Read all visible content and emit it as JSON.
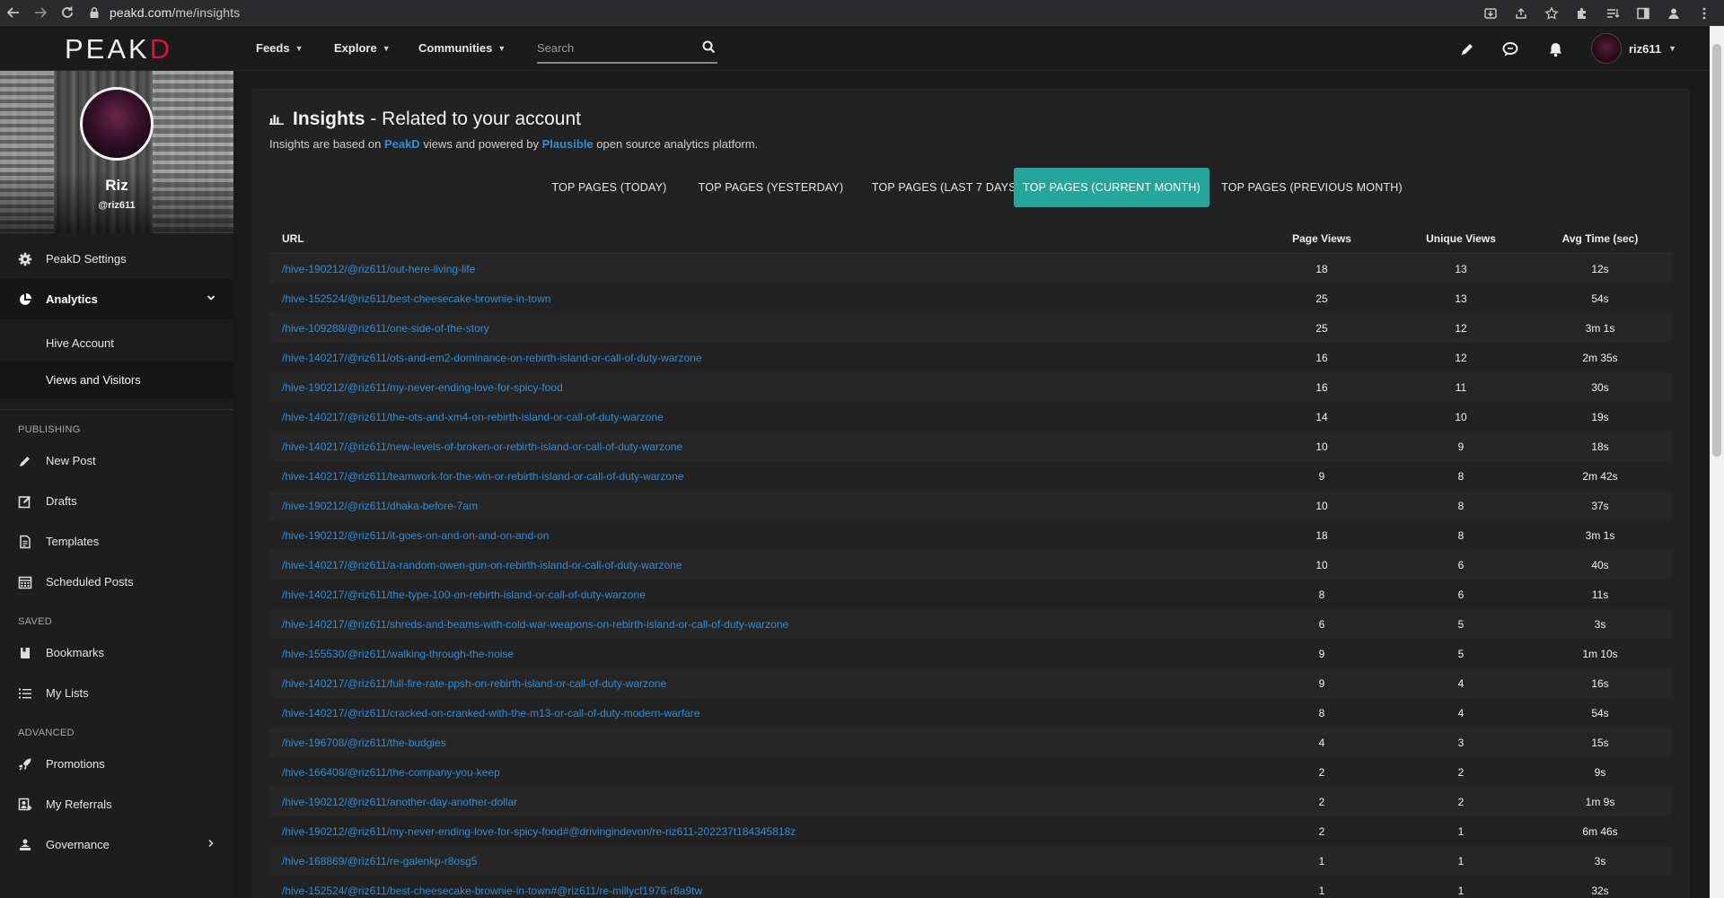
{
  "browser": {
    "url_host": "peakd.com",
    "url_path": "/me/insights"
  },
  "app": {
    "logo_main": "PEAK",
    "logo_accent": "D",
    "nav": [
      "Feeds",
      "Explore",
      "Communities"
    ],
    "search_placeholder": "Search",
    "username": "riz611",
    "accent_color": "#26a69a",
    "link_color": "#2f8dd8",
    "brand_red": "#e31337"
  },
  "profile": {
    "name": "Riz",
    "handle": "@riz611"
  },
  "sidebar": {
    "settings": "PeakD Settings",
    "analytics": "Analytics",
    "analytics_sub": [
      "Hive Account",
      "Views and Visitors"
    ],
    "sections": {
      "publishing": "PUBLISHING",
      "saved": "SAVED",
      "advanced": "ADVANCED"
    },
    "publishing": [
      "New Post",
      "Drafts",
      "Templates",
      "Scheduled Posts"
    ],
    "saved": [
      "Bookmarks",
      "My Lists"
    ],
    "advanced": [
      "Promotions",
      "My Referrals",
      "Governance"
    ]
  },
  "insights": {
    "title_bold": "Insights",
    "title_rest": "- Related to your account",
    "desc_1": "Insights are based on",
    "desc_link_1": "PeakD",
    "desc_2": "views and powered by",
    "desc_link_2": "Plausible",
    "desc_3": "open source analytics platform.",
    "tabs": [
      "TOP PAGES (TODAY)",
      "TOP PAGES (YESTERDAY)",
      "TOP PAGES (LAST 7 DAYS)",
      "TOP PAGES (CURRENT MONTH)",
      "TOP PAGES (PREVIOUS MONTH)"
    ],
    "active_tab": 3,
    "columns": [
      "URL",
      "Page Views",
      "Unique Views",
      "Avg Time (sec)"
    ],
    "rows": [
      {
        "url": "/hive-190212/@riz611/out-here-living-life",
        "views": "18",
        "unique": "13",
        "avg": "12s"
      },
      {
        "url": "/hive-152524/@riz611/best-cheesecake-brownie-in-town",
        "views": "25",
        "unique": "13",
        "avg": "54s"
      },
      {
        "url": "/hive-109288/@riz611/one-side-of-the-story",
        "views": "25",
        "unique": "12",
        "avg": "3m 1s"
      },
      {
        "url": "/hive-140217/@riz611/ots-and-em2-dominance-on-rebirth-island-or-call-of-duty-warzone",
        "views": "16",
        "unique": "12",
        "avg": "2m 35s"
      },
      {
        "url": "/hive-190212/@riz611/my-never-ending-love-for-spicy-food",
        "views": "16",
        "unique": "11",
        "avg": "30s"
      },
      {
        "url": "/hive-140217/@riz611/the-ots-and-xm4-on-rebirth-island-or-call-of-duty-warzone",
        "views": "14",
        "unique": "10",
        "avg": "19s"
      },
      {
        "url": "/hive-140217/@riz611/new-levels-of-broken-or-rebirth-island-or-call-of-duty-warzone",
        "views": "10",
        "unique": "9",
        "avg": "18s"
      },
      {
        "url": "/hive-140217/@riz611/teamwork-for-the-win-or-rebirth-island-or-call-of-duty-warzone",
        "views": "9",
        "unique": "8",
        "avg": "2m 42s"
      },
      {
        "url": "/hive-190212/@riz611/dhaka-before-7am",
        "views": "10",
        "unique": "8",
        "avg": "37s"
      },
      {
        "url": "/hive-190212/@riz611/it-goes-on-and-on-and-on-and-on",
        "views": "18",
        "unique": "8",
        "avg": "3m 1s"
      },
      {
        "url": "/hive-140217/@riz611/a-random-owen-gun-on-rebirth-island-or-call-of-duty-warzone",
        "views": "10",
        "unique": "6",
        "avg": "40s"
      },
      {
        "url": "/hive-140217/@riz611/the-type-100-on-rebirth-island-or-call-of-duty-warzone",
        "views": "8",
        "unique": "6",
        "avg": "11s"
      },
      {
        "url": "/hive-140217/@riz611/shreds-and-beams-with-cold-war-weapons-on-rebirth-island-or-call-of-duty-warzone",
        "views": "6",
        "unique": "5",
        "avg": "3s"
      },
      {
        "url": "/hive-155530/@riz611/walking-through-the-noise",
        "views": "9",
        "unique": "5",
        "avg": "1m 10s"
      },
      {
        "url": "/hive-140217/@riz611/full-fire-rate-ppsh-on-rebirth-island-or-call-of-duty-warzone",
        "views": "9",
        "unique": "4",
        "avg": "16s"
      },
      {
        "url": "/hive-140217/@riz611/cracked-on-cranked-with-the-m13-or-call-of-duty-modern-warfare",
        "views": "8",
        "unique": "4",
        "avg": "54s"
      },
      {
        "url": "/hive-196708/@riz611/the-budgies",
        "views": "4",
        "unique": "3",
        "avg": "15s"
      },
      {
        "url": "/hive-166408/@riz611/the-company-you-keep",
        "views": "2",
        "unique": "2",
        "avg": "9s"
      },
      {
        "url": "/hive-190212/@riz611/another-day-another-dollar",
        "views": "2",
        "unique": "2",
        "avg": "1m 9s"
      },
      {
        "url": "/hive-190212/@riz611/my-never-ending-love-for-spicy-food#@drivingindevon/re-riz611-202237t184345818z",
        "views": "2",
        "unique": "1",
        "avg": "6m 46s"
      },
      {
        "url": "/hive-168869/@riz611/re-galenkp-r8osg5",
        "views": "1",
        "unique": "1",
        "avg": "3s"
      },
      {
        "url": "/hive-152524/@riz611/best-cheesecake-brownie-in-town#@riz611/re-millycf1976-r8a9tw",
        "views": "1",
        "unique": "1",
        "avg": "32s"
      }
    ]
  }
}
